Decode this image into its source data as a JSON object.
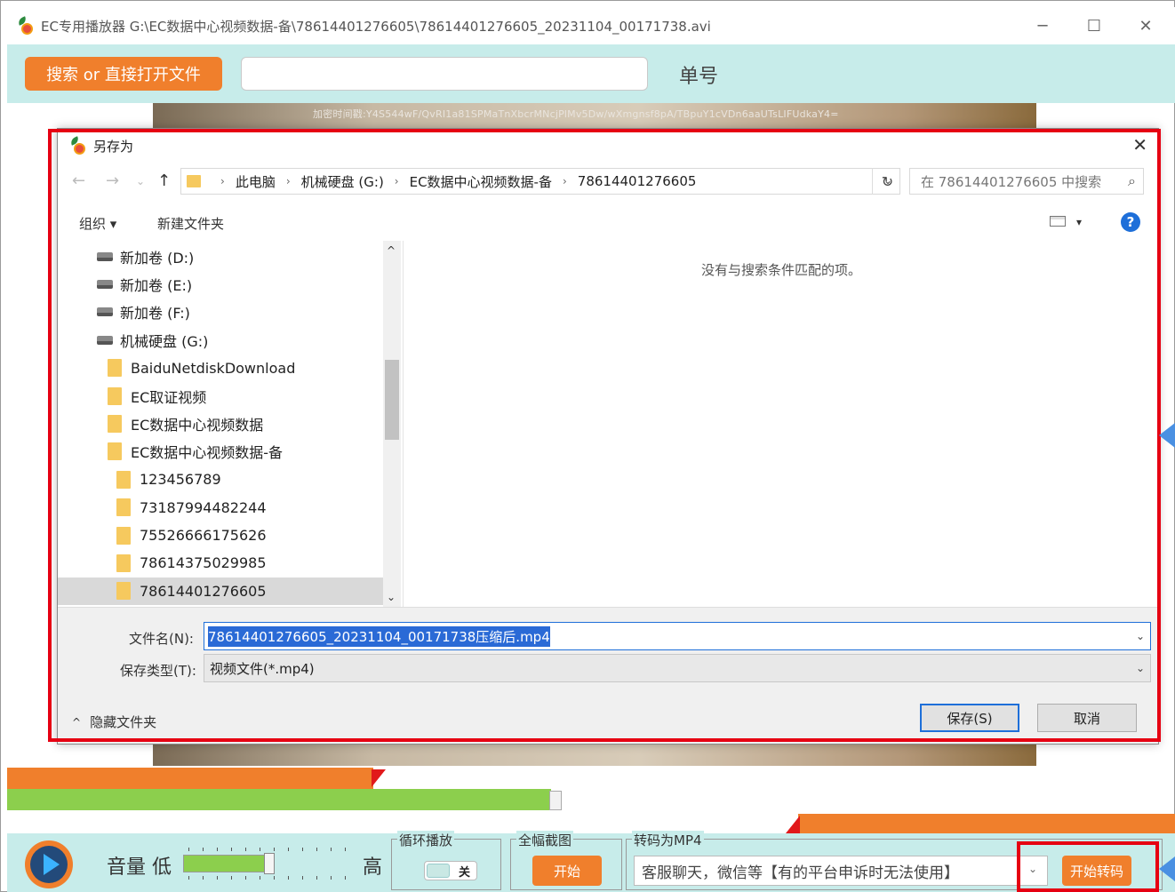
{
  "window": {
    "title": "EC专用播放器 G:\\EC数据中心视频数据-备\\78614401276605\\78614401276605_20231104_00171738.avi",
    "minimize": "─",
    "maximize": "☐",
    "close": "✕"
  },
  "searchbar": {
    "button_label": "搜索 or 直接打开文件",
    "input_value": "",
    "order_label": "单号"
  },
  "video": {
    "watermark": "加密时间戳:Y4S544wF/QvRI1a81SPMaTnXbcrMNcjPlMv5Dw/wXmgnsf8pA/TBpuY1cVDn6aaUTsLIFUdkaY4="
  },
  "dialog": {
    "title": "另存为",
    "close": "✕",
    "nav": {
      "back": "←",
      "forward": "→",
      "recent": "⌄",
      "up": "↑"
    },
    "breadcrumbs": [
      "此电脑",
      "机械硬盘 (G:)",
      "EC数据中心视频数据-备",
      "78614401276605"
    ],
    "breadcrumb_sep": "›",
    "refresh": "↻",
    "search_placeholder": "在 78614401276605 中搜索",
    "search_icon": "⌕",
    "toolbar": {
      "organize": "组织 ▾",
      "new_folder": "新建文件夹",
      "view_drop": "▾",
      "help": "?"
    },
    "tree": [
      {
        "label": "新加卷 (D:)",
        "type": "drive"
      },
      {
        "label": "新加卷 (E:)",
        "type": "drive"
      },
      {
        "label": "新加卷 (F:)",
        "type": "drive"
      },
      {
        "label": "机械硬盘 (G:)",
        "type": "drive"
      },
      {
        "label": "BaiduNetdiskDownload",
        "type": "folder"
      },
      {
        "label": "EC取证视频",
        "type": "folder"
      },
      {
        "label": "EC数据中心视频数据",
        "type": "folder"
      },
      {
        "label": "EC数据中心视频数据-备",
        "type": "folder"
      },
      {
        "label": "123456789",
        "type": "subfolder"
      },
      {
        "label": "73187994482244",
        "type": "subfolder"
      },
      {
        "label": "75526666175626",
        "type": "subfolder"
      },
      {
        "label": "78614375029985",
        "type": "subfolder"
      },
      {
        "label": "78614401276605",
        "type": "subfolder",
        "selected": true
      }
    ],
    "scroll_up": "^",
    "scroll_down": "⌄",
    "empty_message": "没有与搜索条件匹配的项。",
    "filename_label": "文件名(N):",
    "filename_value": "78614401276605_20231104_00171738压缩后.mp4",
    "filetype_label": "保存类型(T):",
    "filetype_value": "视频文件(*.mp4)",
    "dropdown_arrow": "⌄",
    "hide_folders": "隐藏文件夹",
    "hide_folders_icon": "^",
    "save_label": "保存(S)",
    "cancel_label": "取消"
  },
  "controls": {
    "volume_label": "音量 低",
    "volume_high": "高",
    "volume_level": 0.5,
    "loop_group": "循环播放",
    "loop_toggle": "关",
    "screenshot_group": "全幅截图",
    "screenshot_start": "开始",
    "mp4_group": "转码为MP4",
    "mp4_option": "客服聊天，微信等【有的平台申诉时无法使用】",
    "mp4_drop": "⌄",
    "transcode_label": "开始转码"
  },
  "colors": {
    "accent_orange": "#f07f2c",
    "panel_teal": "#c7ecea",
    "progress_green": "#8ccf4d",
    "highlight_red": "#e60012"
  }
}
